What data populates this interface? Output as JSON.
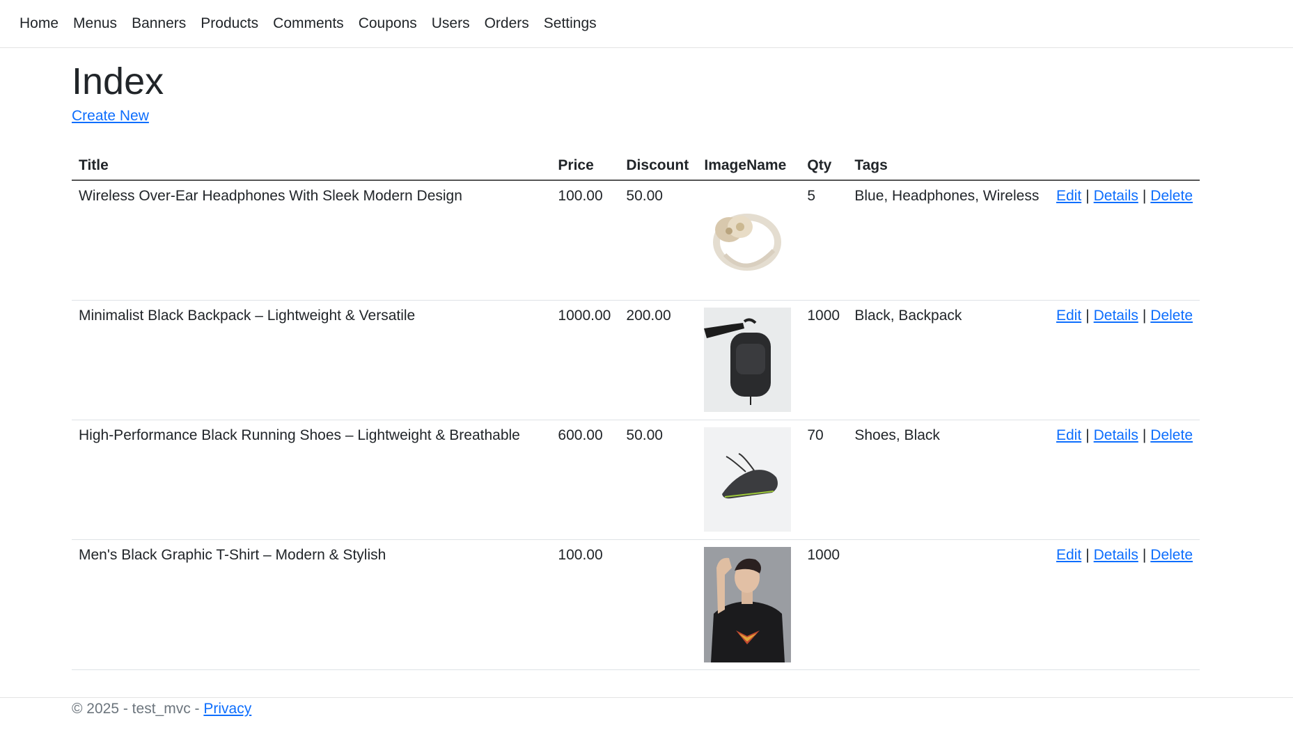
{
  "nav": {
    "items": [
      "Home",
      "Menus",
      "Banners",
      "Products",
      "Comments",
      "Coupons",
      "Users",
      "Orders",
      "Settings"
    ]
  },
  "page": {
    "title": "Index",
    "create_link": "Create New"
  },
  "table": {
    "headers": [
      "Title",
      "Price",
      "Discount",
      "ImageName",
      "Qty",
      "Tags"
    ],
    "rows": [
      {
        "title": "Wireless Over-Ear Headphones With Sleek Modern Design",
        "price": "100.00",
        "discount": "50.00",
        "image": "headphones-image",
        "qty": "5",
        "tags": "Blue, Headphones, Wireless"
      },
      {
        "title": "Minimalist Black Backpack – Lightweight & Versatile",
        "price": "1000.00",
        "discount": "200.00",
        "image": "backpack-image",
        "qty": "1000",
        "tags": "Black, Backpack"
      },
      {
        "title": "High-Performance Black Running Shoes – Lightweight & Breathable",
        "price": "600.00",
        "discount": "50.00",
        "image": "shoe-image",
        "qty": "70",
        "tags": "Shoes, Black"
      },
      {
        "title": "Men's Black Graphic T-Shirt – Modern & Stylish",
        "price": "100.00",
        "discount": "",
        "image": "tshirt-image",
        "qty": "1000",
        "tags": ""
      }
    ],
    "actions": {
      "edit": "Edit",
      "details": "Details",
      "delete": "Delete",
      "separator": "|"
    }
  },
  "footer": {
    "text": "© 2025 - test_mvc - ",
    "privacy": "Privacy"
  },
  "colors": {
    "link": "#0d6efd",
    "text": "#212529",
    "muted": "#6c757d"
  }
}
